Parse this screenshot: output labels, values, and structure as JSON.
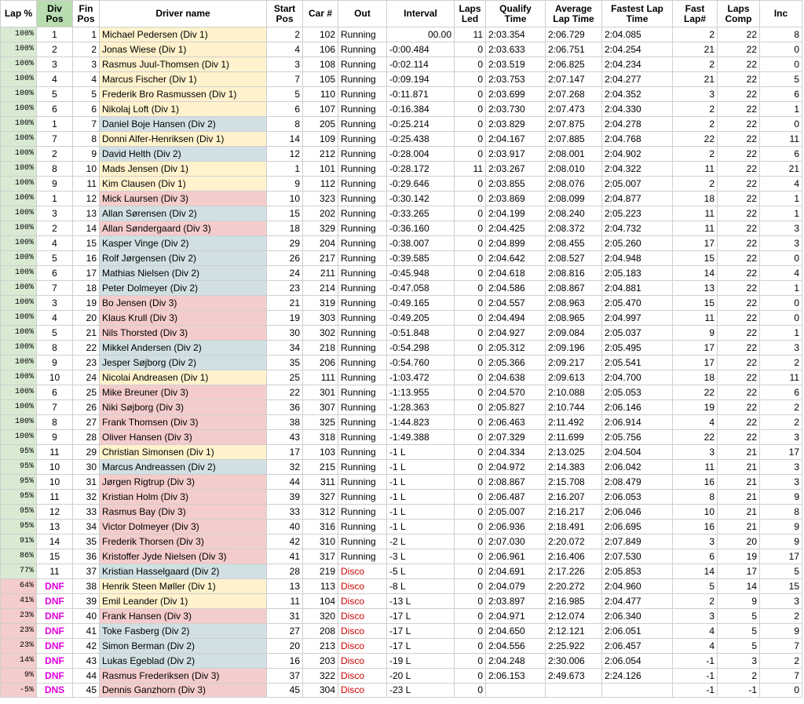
{
  "headers": {
    "lap_pct": "Lap %",
    "div_pos": [
      "Div",
      "Pos"
    ],
    "fin_pos": [
      "Fin",
      "Pos"
    ],
    "driver": "Driver name",
    "start_pos": [
      "Start",
      "Pos"
    ],
    "car": "Car #",
    "out": "Out",
    "interval": "Interval",
    "laps_led": [
      "Laps",
      "Led"
    ],
    "qualify": [
      "Qualify",
      "Time"
    ],
    "avg_lap": [
      "Average",
      "Lap Time"
    ],
    "fastest_lap": [
      "Fastest Lap",
      "Time"
    ],
    "fast_lap_num": [
      "Fast",
      "Lap#"
    ],
    "laps_comp": [
      "Laps",
      "Comp"
    ],
    "inc": "Inc"
  },
  "colors": {
    "div1": "#fff2cc",
    "div2": "#d0e0e3",
    "div3": "#f4cccc",
    "lap_ok": "#d9ead3",
    "lap_low": "#f4cccc",
    "dnf_text": "#e000e0",
    "disco_text": "#cc0000",
    "div_header": "#b9dcb0"
  },
  "rows": [
    {
      "lap": "100%",
      "div": "1",
      "fin": "1",
      "driver": "Michael Pedersen (Div 1)",
      "d": 1,
      "start": "2",
      "car": "102",
      "out": "Running",
      "interval": "00.00",
      "led": "11",
      "qual": "2:03.354",
      "avg": "2:06.729",
      "fast": "2:04.085",
      "flap": "2",
      "comp": "22",
      "inc": "8"
    },
    {
      "lap": "100%",
      "div": "2",
      "fin": "2",
      "driver": "Jonas Wiese (Div 1)",
      "d": 1,
      "start": "4",
      "car": "106",
      "out": "Running",
      "interval": "-0:00.484",
      "led": "0",
      "qual": "2:03.633",
      "avg": "2:06.751",
      "fast": "2:04.254",
      "flap": "21",
      "comp": "22",
      "inc": "0"
    },
    {
      "lap": "100%",
      "div": "3",
      "fin": "3",
      "driver": "Rasmus Juul-Thomsen (Div 1)",
      "d": 1,
      "start": "3",
      "car": "108",
      "out": "Running",
      "interval": "-0:02.114",
      "led": "0",
      "qual": "2:03.519",
      "avg": "2:06.825",
      "fast": "2:04.234",
      "flap": "2",
      "comp": "22",
      "inc": "0"
    },
    {
      "lap": "100%",
      "div": "4",
      "fin": "4",
      "driver": "Marcus Fischer (Div 1)",
      "d": 1,
      "start": "7",
      "car": "105",
      "out": "Running",
      "interval": "-0:09.194",
      "led": "0",
      "qual": "2:03.753",
      "avg": "2:07.147",
      "fast": "2:04.277",
      "flap": "21",
      "comp": "22",
      "inc": "5"
    },
    {
      "lap": "100%",
      "div": "5",
      "fin": "5",
      "driver": "Frederik Bro Rasmussen (Div 1)",
      "d": 1,
      "start": "5",
      "car": "110",
      "out": "Running",
      "interval": "-0:11.871",
      "led": "0",
      "qual": "2:03.699",
      "avg": "2:07.268",
      "fast": "2:04.352",
      "flap": "3",
      "comp": "22",
      "inc": "6"
    },
    {
      "lap": "100%",
      "div": "6",
      "fin": "6",
      "driver": "Nikolaj Loft (Div 1)",
      "d": 1,
      "start": "6",
      "car": "107",
      "out": "Running",
      "interval": "-0:16.384",
      "led": "0",
      "qual": "2:03.730",
      "avg": "2:07.473",
      "fast": "2:04.330",
      "flap": "2",
      "comp": "22",
      "inc": "1"
    },
    {
      "lap": "100%",
      "div": "1",
      "fin": "7",
      "driver": "Daniel Boje Hansen (Div 2)",
      "d": 2,
      "start": "8",
      "car": "205",
      "out": "Running",
      "interval": "-0:25.214",
      "led": "0",
      "qual": "2:03.829",
      "avg": "2:07.875",
      "fast": "2:04.278",
      "flap": "2",
      "comp": "22",
      "inc": "0"
    },
    {
      "lap": "100%",
      "div": "7",
      "fin": "8",
      "driver": "Donni Alfer-Henriksen (Div 1)",
      "d": 1,
      "start": "14",
      "car": "109",
      "out": "Running",
      "interval": "-0:25.438",
      "led": "0",
      "qual": "2:04.167",
      "avg": "2:07.885",
      "fast": "2:04.768",
      "flap": "22",
      "comp": "22",
      "inc": "11"
    },
    {
      "lap": "100%",
      "div": "2",
      "fin": "9",
      "driver": "David Helth (Div 2)",
      "d": 2,
      "start": "12",
      "car": "212",
      "out": "Running",
      "interval": "-0:28.004",
      "led": "0",
      "qual": "2:03.917",
      "avg": "2:08.001",
      "fast": "2:04.902",
      "flap": "2",
      "comp": "22",
      "inc": "6"
    },
    {
      "lap": "100%",
      "div": "8",
      "fin": "10",
      "driver": "Mads Jensen (Div 1)",
      "d": 1,
      "start": "1",
      "car": "101",
      "out": "Running",
      "interval": "-0:28.172",
      "led": "11",
      "qual": "2:03.267",
      "avg": "2:08.010",
      "fast": "2:04.322",
      "flap": "11",
      "comp": "22",
      "inc": "21"
    },
    {
      "lap": "100%",
      "div": "9",
      "fin": "11",
      "driver": "Kim Clausen (Div 1)",
      "d": 1,
      "start": "9",
      "car": "112",
      "out": "Running",
      "interval": "-0:29.646",
      "led": "0",
      "qual": "2:03.855",
      "avg": "2:08.076",
      "fast": "2:05.007",
      "flap": "2",
      "comp": "22",
      "inc": "4"
    },
    {
      "lap": "100%",
      "div": "1",
      "fin": "12",
      "driver": "Mick Laursen (Div 3)",
      "d": 3,
      "start": "10",
      "car": "323",
      "out": "Running",
      "interval": "-0:30.142",
      "led": "0",
      "qual": "2:03.869",
      "avg": "2:08.099",
      "fast": "2:04.877",
      "flap": "18",
      "comp": "22",
      "inc": "1"
    },
    {
      "lap": "100%",
      "div": "3",
      "fin": "13",
      "driver": "Allan Sørensen (Div 2)",
      "d": 2,
      "start": "15",
      "car": "202",
      "out": "Running",
      "interval": "-0:33.265",
      "led": "0",
      "qual": "2:04.199",
      "avg": "2:08.240",
      "fast": "2:05.223",
      "flap": "11",
      "comp": "22",
      "inc": "1"
    },
    {
      "lap": "100%",
      "div": "2",
      "fin": "14",
      "driver": "Allan Søndergaard (Div 3)",
      "d": 3,
      "start": "18",
      "car": "329",
      "out": "Running",
      "interval": "-0:36.160",
      "led": "0",
      "qual": "2:04.425",
      "avg": "2:08.372",
      "fast": "2:04.732",
      "flap": "11",
      "comp": "22",
      "inc": "3"
    },
    {
      "lap": "100%",
      "div": "4",
      "fin": "15",
      "driver": "Kasper Vinge (Div 2)",
      "d": 2,
      "start": "29",
      "car": "204",
      "out": "Running",
      "interval": "-0:38.007",
      "led": "0",
      "qual": "2:04.899",
      "avg": "2:08.455",
      "fast": "2:05.260",
      "flap": "17",
      "comp": "22",
      "inc": "3"
    },
    {
      "lap": "100%",
      "div": "5",
      "fin": "16",
      "driver": "Rolf Jørgensen (Div 2)",
      "d": 2,
      "start": "26",
      "car": "217",
      "out": "Running",
      "interval": "-0:39.585",
      "led": "0",
      "qual": "2:04.642",
      "avg": "2:08.527",
      "fast": "2:04.948",
      "flap": "15",
      "comp": "22",
      "inc": "0"
    },
    {
      "lap": "100%",
      "div": "6",
      "fin": "17",
      "driver": "Mathias Nielsen (Div 2)",
      "d": 2,
      "start": "24",
      "car": "211",
      "out": "Running",
      "interval": "-0:45.948",
      "led": "0",
      "qual": "2:04.618",
      "avg": "2:08.816",
      "fast": "2:05.183",
      "flap": "14",
      "comp": "22",
      "inc": "4"
    },
    {
      "lap": "100%",
      "div": "7",
      "fin": "18",
      "driver": "Peter Dolmeyer (Div 2)",
      "d": 2,
      "start": "23",
      "car": "214",
      "out": "Running",
      "interval": "-0:47.058",
      "led": "0",
      "qual": "2:04.586",
      "avg": "2:08.867",
      "fast": "2:04.881",
      "flap": "13",
      "comp": "22",
      "inc": "1"
    },
    {
      "lap": "100%",
      "div": "3",
      "fin": "19",
      "driver": "Bo Jensen (Div 3)",
      "d": 3,
      "start": "21",
      "car": "319",
      "out": "Running",
      "interval": "-0:49.165",
      "led": "0",
      "qual": "2:04.557",
      "avg": "2:08.963",
      "fast": "2:05.470",
      "flap": "15",
      "comp": "22",
      "inc": "0"
    },
    {
      "lap": "100%",
      "div": "4",
      "fin": "20",
      "driver": "Klaus Krull (Div 3)",
      "d": 3,
      "start": "19",
      "car": "303",
      "out": "Running",
      "interval": "-0:49.205",
      "led": "0",
      "qual": "2:04.494",
      "avg": "2:08.965",
      "fast": "2:04.997",
      "flap": "11",
      "comp": "22",
      "inc": "0"
    },
    {
      "lap": "100%",
      "div": "5",
      "fin": "21",
      "driver": "Nils Thorsted (Div 3)",
      "d": 3,
      "start": "30",
      "car": "302",
      "out": "Running",
      "interval": "-0:51.848",
      "led": "0",
      "qual": "2:04.927",
      "avg": "2:09.084",
      "fast": "2:05.037",
      "flap": "9",
      "comp": "22",
      "inc": "1"
    },
    {
      "lap": "100%",
      "div": "8",
      "fin": "22",
      "driver": "Mikkel Andersen (Div 2)",
      "d": 2,
      "start": "34",
      "car": "218",
      "out": "Running",
      "interval": "-0:54.298",
      "led": "0",
      "qual": "2:05.312",
      "avg": "2:09.196",
      "fast": "2:05.495",
      "flap": "17",
      "comp": "22",
      "inc": "3"
    },
    {
      "lap": "100%",
      "div": "9",
      "fin": "23",
      "driver": "Jesper Søjborg (Div 2)",
      "d": 2,
      "start": "35",
      "car": "206",
      "out": "Running",
      "interval": "-0:54.760",
      "led": "0",
      "qual": "2:05.366",
      "avg": "2:09.217",
      "fast": "2:05.541",
      "flap": "17",
      "comp": "22",
      "inc": "2"
    },
    {
      "lap": "100%",
      "div": "10",
      "fin": "24",
      "driver": "Nicolai Andreasen (Div 1)",
      "d": 1,
      "start": "25",
      "car": "111",
      "out": "Running",
      "interval": "-1:03.472",
      "led": "0",
      "qual": "2:04.638",
      "avg": "2:09.613",
      "fast": "2:04.700",
      "flap": "18",
      "comp": "22",
      "inc": "11"
    },
    {
      "lap": "100%",
      "div": "6",
      "fin": "25",
      "driver": "Mike Breuner (Div 3)",
      "d": 3,
      "start": "22",
      "car": "301",
      "out": "Running",
      "interval": "-1:13.955",
      "led": "0",
      "qual": "2:04.570",
      "avg": "2:10.088",
      "fast": "2:05.053",
      "flap": "22",
      "comp": "22",
      "inc": "6"
    },
    {
      "lap": "100%",
      "div": "7",
      "fin": "26",
      "driver": "Niki Søjborg (Div 3)",
      "d": 3,
      "start": "36",
      "car": "307",
      "out": "Running",
      "interval": "-1:28.363",
      "led": "0",
      "qual": "2:05.827",
      "avg": "2:10.744",
      "fast": "2:06.146",
      "flap": "19",
      "comp": "22",
      "inc": "2"
    },
    {
      "lap": "100%",
      "div": "8",
      "fin": "27",
      "driver": "Frank Thomsen (Div 3)",
      "d": 3,
      "start": "38",
      "car": "325",
      "out": "Running",
      "interval": "-1:44.823",
      "led": "0",
      "qual": "2:06.463",
      "avg": "2:11.492",
      "fast": "2:06.914",
      "flap": "4",
      "comp": "22",
      "inc": "2"
    },
    {
      "lap": "100%",
      "div": "9",
      "fin": "28",
      "driver": "Oliver Hansen (Div 3)",
      "d": 3,
      "start": "43",
      "car": "318",
      "out": "Running",
      "interval": "-1:49.388",
      "led": "0",
      "qual": "2:07.329",
      "avg": "2:11.699",
      "fast": "2:05.756",
      "flap": "22",
      "comp": "22",
      "inc": "3"
    },
    {
      "lap": "95%",
      "div": "11",
      "fin": "29",
      "driver": "Christian Simonsen (Div 1)",
      "d": 1,
      "start": "17",
      "car": "103",
      "out": "Running",
      "interval": "-1 L",
      "led": "0",
      "qual": "2:04.334",
      "avg": "2:13.025",
      "fast": "2:04.504",
      "flap": "3",
      "comp": "21",
      "inc": "17"
    },
    {
      "lap": "95%",
      "div": "10",
      "fin": "30",
      "driver": "Marcus Andreassen (Div 2)",
      "d": 2,
      "start": "32",
      "car": "215",
      "out": "Running",
      "interval": "-1 L",
      "led": "0",
      "qual": "2:04.972",
      "avg": "2:14.383",
      "fast": "2:06.042",
      "flap": "11",
      "comp": "21",
      "inc": "3"
    },
    {
      "lap": "95%",
      "div": "10",
      "fin": "31",
      "driver": "Jørgen Rigtrup (Div 3)",
      "d": 3,
      "start": "44",
      "car": "311",
      "out": "Running",
      "interval": "-1 L",
      "led": "0",
      "qual": "2:08.867",
      "avg": "2:15.708",
      "fast": "2:08.479",
      "flap": "16",
      "comp": "21",
      "inc": "3"
    },
    {
      "lap": "95%",
      "div": "11",
      "fin": "32",
      "driver": "Kristian Holm (Div 3)",
      "d": 3,
      "start": "39",
      "car": "327",
      "out": "Running",
      "interval": "-1 L",
      "led": "0",
      "qual": "2:06.487",
      "avg": "2:16.207",
      "fast": "2:06.053",
      "flap": "8",
      "comp": "21",
      "inc": "9"
    },
    {
      "lap": "95%",
      "div": "12",
      "fin": "33",
      "driver": "Rasmus Bay (Div 3)",
      "d": 3,
      "start": "33",
      "car": "312",
      "out": "Running",
      "interval": "-1 L",
      "led": "0",
      "qual": "2:05.007",
      "avg": "2:16.217",
      "fast": "2:06.046",
      "flap": "10",
      "comp": "21",
      "inc": "8"
    },
    {
      "lap": "95%",
      "div": "13",
      "fin": "34",
      "driver": "Victor Dolmeyer (Div 3)",
      "d": 3,
      "start": "40",
      "car": "316",
      "out": "Running",
      "interval": "-1 L",
      "led": "0",
      "qual": "2:06.936",
      "avg": "2:18.491",
      "fast": "2:06.695",
      "flap": "16",
      "comp": "21",
      "inc": "9"
    },
    {
      "lap": "91%",
      "div": "14",
      "fin": "35",
      "driver": "Frederik Thorsen (Div 3)",
      "d": 3,
      "start": "42",
      "car": "310",
      "out": "Running",
      "interval": "-2 L",
      "led": "0",
      "qual": "2:07.030",
      "avg": "2:20.072",
      "fast": "2:07.849",
      "flap": "3",
      "comp": "20",
      "inc": "9"
    },
    {
      "lap": "86%",
      "div": "15",
      "fin": "36",
      "driver": "Kristoffer Jyde Nielsen (Div 3)",
      "d": 3,
      "start": "41",
      "car": "317",
      "out": "Running",
      "interval": "-3 L",
      "led": "0",
      "qual": "2:06.961",
      "avg": "2:16.406",
      "fast": "2:07.530",
      "flap": "6",
      "comp": "19",
      "inc": "17"
    },
    {
      "lap": "77%",
      "div": "11",
      "fin": "37",
      "driver": "Kristian Hasselgaard (Div 2)",
      "d": 2,
      "start": "28",
      "car": "219",
      "out": "Disco",
      "interval": "-5 L",
      "led": "0",
      "qual": "2:04.691",
      "avg": "2:17.226",
      "fast": "2:05.853",
      "flap": "14",
      "comp": "17",
      "inc": "5"
    },
    {
      "lap": "64%",
      "div": "DNF",
      "fin": "38",
      "driver": "Henrik Steen Møller (Div 1)",
      "d": 1,
      "start": "13",
      "car": "113",
      "out": "Disco",
      "interval": "-8 L",
      "led": "0",
      "qual": "2:04.079",
      "avg": "2:20.272",
      "fast": "2:04.960",
      "flap": "5",
      "comp": "14",
      "inc": "15"
    },
    {
      "lap": "41%",
      "div": "DNF",
      "fin": "39",
      "driver": "Emil Leander (Div 1)",
      "d": 1,
      "start": "11",
      "car": "104",
      "out": "Disco",
      "interval": "-13 L",
      "led": "0",
      "qual": "2:03.897",
      "avg": "2:16.985",
      "fast": "2:04.477",
      "flap": "2",
      "comp": "9",
      "inc": "3"
    },
    {
      "lap": "23%",
      "div": "DNF",
      "fin": "40",
      "driver": "Frank Hansen (Div 3)",
      "d": 3,
      "start": "31",
      "car": "320",
      "out": "Disco",
      "interval": "-17 L",
      "led": "0",
      "qual": "2:04.971",
      "avg": "2:12.074",
      "fast": "2:06.340",
      "flap": "3",
      "comp": "5",
      "inc": "2"
    },
    {
      "lap": "23%",
      "div": "DNF",
      "fin": "41",
      "driver": "Toke Fasberg (Div 2)",
      "d": 2,
      "start": "27",
      "car": "208",
      "out": "Disco",
      "interval": "-17 L",
      "led": "0",
      "qual": "2:04.650",
      "avg": "2:12.121",
      "fast": "2:06.051",
      "flap": "4",
      "comp": "5",
      "inc": "9"
    },
    {
      "lap": "23%",
      "div": "DNF",
      "fin": "42",
      "driver": "Simon Berman (Div 2)",
      "d": 2,
      "start": "20",
      "car": "213",
      "out": "Disco",
      "interval": "-17 L",
      "led": "0",
      "qual": "2:04.556",
      "avg": "2:25.922",
      "fast": "2:06.457",
      "flap": "4",
      "comp": "5",
      "inc": "7"
    },
    {
      "lap": "14%",
      "div": "DNF",
      "fin": "43",
      "driver": "Lukas Egeblad (Div 2)",
      "d": 2,
      "start": "16",
      "car": "203",
      "out": "Disco",
      "interval": "-19 L",
      "led": "0",
      "qual": "2:04.248",
      "avg": "2:30.006",
      "fast": "2:06.054",
      "flap": "-1",
      "comp": "3",
      "inc": "2"
    },
    {
      "lap": "9%",
      "div": "DNF",
      "fin": "44",
      "driver": "Rasmus Frederiksen (Div 3)",
      "d": 3,
      "start": "37",
      "car": "322",
      "out": "Disco",
      "interval": "-20 L",
      "led": "0",
      "qual": "2:06.153",
      "avg": "2:49.673",
      "fast": "2:24.126",
      "flap": "-1",
      "comp": "2",
      "inc": "7"
    },
    {
      "lap": "-5%",
      "div": "DNS",
      "fin": "45",
      "driver": "Dennis Ganzhorn (Div 3)",
      "d": 3,
      "start": "45",
      "car": "304",
      "out": "Disco",
      "interval": "-23 L",
      "led": "0",
      "qual": "",
      "avg": "",
      "fast": "",
      "flap": "-1",
      "comp": "-1",
      "inc": "0"
    }
  ]
}
